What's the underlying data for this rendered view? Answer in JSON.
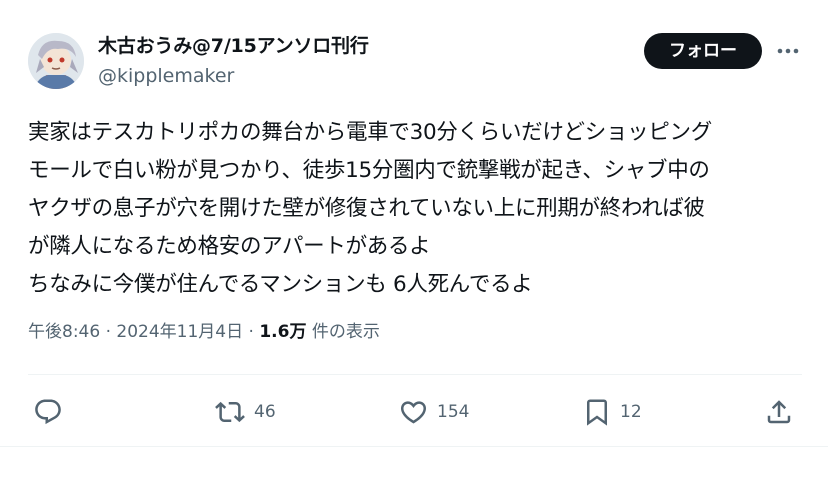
{
  "author": {
    "display_name": "木古おうみ@7/15アンソロ刊行",
    "handle": "@kipplemaker",
    "avatar_icon": "anime-avatar-icon"
  },
  "follow_label": "フォロー",
  "more_icon": "more-dots-icon",
  "tweet_lines": [
    "実家はテスカトリポカの舞台から電車で30分くらいだけどショッピング",
    "モールで白い粉が見つかり、徒歩15分圏内で銃撃戦が起き、シャブ中の",
    "ヤクザの息子が穴を開けた壁が修復されていない上に刑期が終われば彼",
    "が隣人になるため格安のアパートがあるよ",
    "ちなみに今僕が住んでるマンションも 6人死んでるよ"
  ],
  "meta": {
    "time": "午後8:46",
    "separator": "·",
    "date": "2024年11月4日",
    "views": "1.6万",
    "views_label": "件の表示"
  },
  "actions": {
    "reply": {
      "icon": "reply-icon",
      "count": ""
    },
    "retweet": {
      "icon": "retweet-icon",
      "count": "46"
    },
    "like": {
      "icon": "heart-icon",
      "count": "154"
    },
    "bookmark": {
      "icon": "bookmark-icon",
      "count": "12"
    },
    "share": {
      "icon": "share-icon",
      "count": ""
    }
  },
  "colors": {
    "text": "#0f1419",
    "secondary": "#536471",
    "divider": "#eff3f4",
    "button_bg": "#0f1419"
  }
}
